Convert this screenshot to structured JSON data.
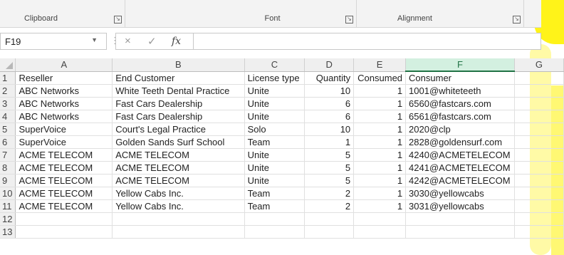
{
  "ribbon": {
    "groups": [
      {
        "label": "Clipboard"
      },
      {
        "label": "Font"
      },
      {
        "label": "Alignment"
      }
    ],
    "launcher_icon": "dialog-launcher-icon"
  },
  "formula_bar": {
    "name_box": "F19",
    "cancel_icon": "×",
    "enter_icon": "✓",
    "fx_label": "fx",
    "formula_value": ""
  },
  "sheet": {
    "columns": [
      "A",
      "B",
      "C",
      "D",
      "E",
      "F",
      "G"
    ],
    "selected_column": "F",
    "rows": [
      {
        "n": "1",
        "cells": [
          "Reseller",
          "End Customer",
          "License type",
          "Quantity",
          "Consumed",
          "Consumer",
          ""
        ]
      },
      {
        "n": "2",
        "cells": [
          "ABC Networks",
          "White Teeth Dental Practice",
          "Unite",
          "10",
          "1",
          "1001@whiteteeth",
          ""
        ]
      },
      {
        "n": "3",
        "cells": [
          "ABC Networks",
          "Fast Cars Dealership",
          "Unite",
          "6",
          "1",
          "6560@fastcars.com",
          ""
        ]
      },
      {
        "n": "4",
        "cells": [
          "ABC Networks",
          "Fast Cars Dealership",
          "Unite",
          "6",
          "1",
          "6561@fastcars.com",
          ""
        ]
      },
      {
        "n": "5",
        "cells": [
          "SuperVoice",
          "Court's Legal Practice",
          "Solo",
          "10",
          "1",
          "2020@clp",
          ""
        ]
      },
      {
        "n": "6",
        "cells": [
          "SuperVoice",
          "Golden Sands Surf School",
          "Team",
          "1",
          "1",
          "2828@goldensurf.com",
          ""
        ]
      },
      {
        "n": "7",
        "cells": [
          "ACME TELECOM",
          "ACME TELECOM",
          "Unite",
          "5",
          "1",
          "4240@ACMETELECOM",
          ""
        ]
      },
      {
        "n": "8",
        "cells": [
          "ACME TELECOM",
          "ACME TELECOM",
          "Unite",
          "5",
          "1",
          "4241@ACMETELECOM",
          ""
        ]
      },
      {
        "n": "9",
        "cells": [
          "ACME TELECOM",
          "ACME TELECOM",
          "Unite",
          "5",
          "1",
          "4242@ACMETELECOM",
          ""
        ]
      },
      {
        "n": "10",
        "cells": [
          "ACME TELECOM",
          "Yellow Cabs Inc.",
          "Team",
          "2",
          "1",
          "3030@yellowcabs",
          ""
        ]
      },
      {
        "n": "11",
        "cells": [
          "ACME TELECOM",
          "Yellow Cabs Inc.",
          "Team",
          "2",
          "1",
          "3031@yellowcabs",
          ""
        ]
      },
      {
        "n": "12",
        "cells": [
          "",
          "",
          "",
          "",
          "",
          "",
          ""
        ]
      },
      {
        "n": "13",
        "cells": [
          "",
          "",
          "",
          "",
          "",
          "",
          ""
        ]
      }
    ]
  },
  "colors": {
    "selected_header": "#217346",
    "highlight": "#fff200"
  }
}
